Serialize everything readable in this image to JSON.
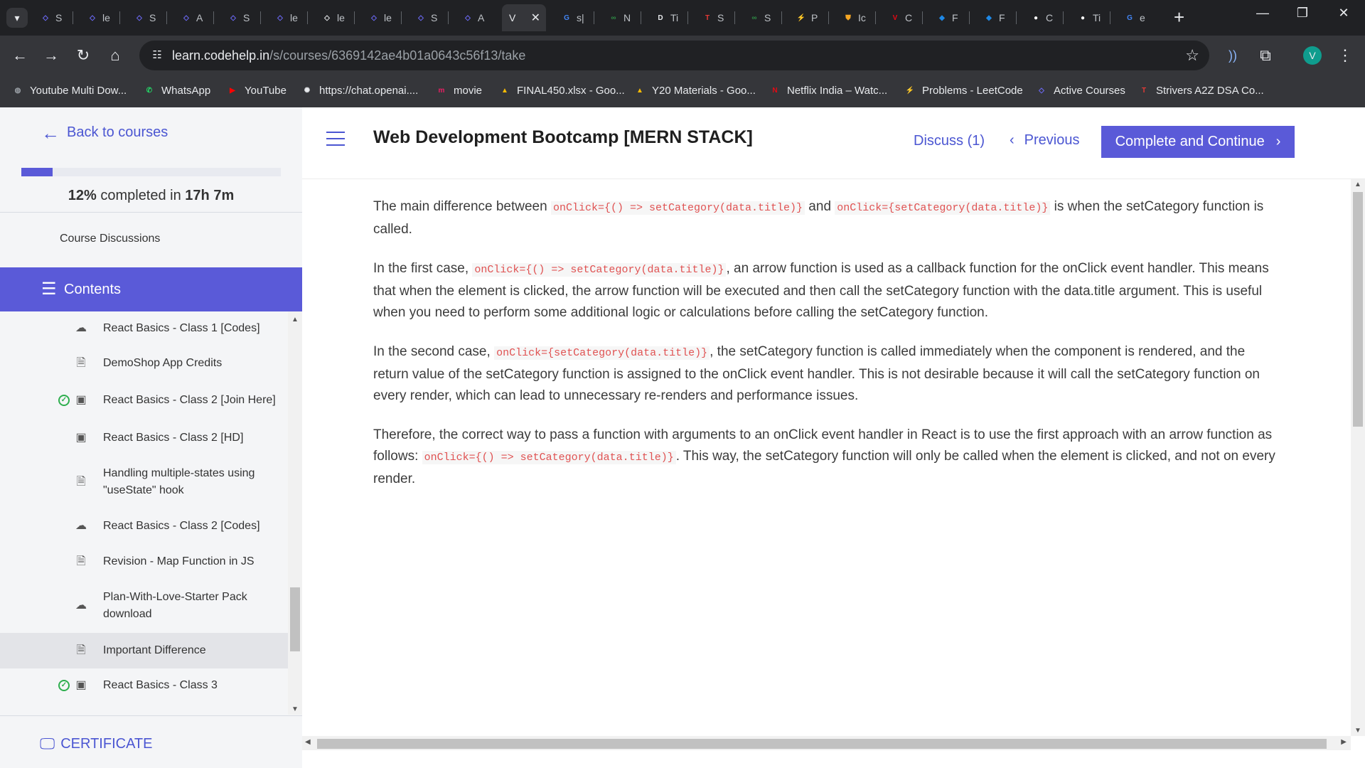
{
  "browser": {
    "tabs": [
      {
        "title": "S",
        "icon": "codehelp-icon",
        "color": "#6f6cff"
      },
      {
        "title": "le",
        "icon": "codehelp-icon",
        "color": "#6f6cff"
      },
      {
        "title": "S",
        "icon": "codehelp-icon",
        "color": "#6f6cff"
      },
      {
        "title": "A",
        "icon": "codehelp-icon",
        "color": "#6f6cff"
      },
      {
        "title": "S",
        "icon": "codehelp-icon",
        "color": "#6f6cff"
      },
      {
        "title": "le",
        "icon": "codehelp-icon",
        "color": "#6f6cff"
      },
      {
        "title": "le",
        "icon": "code-icon",
        "color": "#e8eaed"
      },
      {
        "title": "le",
        "icon": "codehelp-icon",
        "color": "#6f6cff"
      },
      {
        "title": "S",
        "icon": "codehelp-icon",
        "color": "#6f6cff"
      },
      {
        "title": "A",
        "icon": "codehelp-icon",
        "color": "#6f6cff"
      },
      {
        "title": "V",
        "icon": "",
        "color": "#e8eaed",
        "active": true
      },
      {
        "title": "s|",
        "icon": "google-icon",
        "color": "#4285f4"
      },
      {
        "title": "N",
        "icon": "gfg-icon",
        "color": "#2f8d46"
      },
      {
        "title": "Ti",
        "icon": "dev-icon",
        "color": "#e8eaed"
      },
      {
        "title": "S",
        "icon": "tuf-icon",
        "color": "#e53935"
      },
      {
        "title": "S",
        "icon": "gfg-icon",
        "color": "#2f8d46"
      },
      {
        "title": "P",
        "icon": "leetcode-icon",
        "color": "#ffa116"
      },
      {
        "title": "Ic",
        "icon": "shield-icon",
        "color": "#f5a623"
      },
      {
        "title": "C",
        "icon": "v-logo-icon",
        "color": "#e50914"
      },
      {
        "title": "F",
        "icon": "diamond-icon",
        "color": "#1e88e5"
      },
      {
        "title": "F",
        "icon": "diamond-icon",
        "color": "#1e88e5"
      },
      {
        "title": "C",
        "icon": "circle-icon",
        "color": "#ffffff"
      },
      {
        "title": "Ti",
        "icon": "circle-icon",
        "color": "#ffffff"
      },
      {
        "title": "e",
        "icon": "google-icon",
        "color": "#4285f4"
      }
    ],
    "url_domain": "learn.codehelp.in",
    "url_path": "/s/courses/6369142ae4b01a0643c56f13/take",
    "profile_initial": "V",
    "profile_color": "#0f9d8e",
    "bookmarks": [
      {
        "label": "Youtube Multi Dow...",
        "icon": "globe-icon",
        "color": "#9aa0a6"
      },
      {
        "label": "WhatsApp",
        "icon": "whatsapp-icon",
        "color": "#25d366"
      },
      {
        "label": "YouTube",
        "icon": "youtube-icon",
        "color": "#ff0000"
      },
      {
        "label": "https://chat.openai....",
        "icon": "openai-icon",
        "color": "#e8eaed"
      },
      {
        "label": "movie",
        "icon": "movie-icon",
        "color": "#e91e63"
      },
      {
        "label": "FINAL450.xlsx - Goo...",
        "icon": "drive-icon",
        "color": "#fbbc04"
      },
      {
        "label": "Y20 Materials - Goo...",
        "icon": "drive-icon",
        "color": "#fbbc04"
      },
      {
        "label": "Netflix India – Watc...",
        "icon": "netflix-icon",
        "color": "#e50914"
      },
      {
        "label": "Problems - LeetCode",
        "icon": "leetcode-icon",
        "color": "#ffa116"
      },
      {
        "label": "Active Courses",
        "icon": "codehelp-icon",
        "color": "#6f6cff"
      },
      {
        "label": "Strivers A2Z DSA Co...",
        "icon": "tuf-icon",
        "color": "#e53935"
      }
    ]
  },
  "sidebar": {
    "back_label": "Back to courses",
    "progress_percent": 12,
    "progress_pct_text": "12%",
    "progress_mid": " completed in ",
    "progress_time": "17h 7m",
    "course_discussions": "Course Discussions",
    "contents_label": "Contents",
    "lessons": [
      {
        "title": "React Basics - Class 1 [Codes]",
        "type": "download",
        "done": false
      },
      {
        "title": "DemoShop App Credits",
        "type": "document",
        "done": false
      },
      {
        "title": "React Basics - Class 2 [Join Here]",
        "type": "video",
        "done": true
      },
      {
        "title": "React Basics - Class 2 [HD]",
        "type": "video",
        "done": false
      },
      {
        "title": "Handling multiple-states using \"useState\" hook",
        "type": "document",
        "done": false
      },
      {
        "title": "React Basics - Class 2 [Codes]",
        "type": "download",
        "done": false
      },
      {
        "title": "Revision - Map Function in JS",
        "type": "document",
        "done": false
      },
      {
        "title": "Plan-With-Love-Starter Pack download",
        "type": "download",
        "done": false
      },
      {
        "title": "Important Difference",
        "type": "document",
        "done": false,
        "active": true
      },
      {
        "title": "React Basics - Class 3",
        "type": "video",
        "done": true
      }
    ],
    "certificate_label": "CERTIFICATE"
  },
  "header": {
    "course_title": "Web Development Bootcamp [MERN STACK]",
    "discuss_label": "Discuss (1)",
    "previous_label": "Previous",
    "complete_label": "Complete and Continue"
  },
  "article": {
    "p1": {
      "t1": "The main difference between ",
      "c1": "onClick={() => setCategory(data.title)}",
      "t2": " and ",
      "c2": "onClick={setCategory(data.title)}",
      "t3": " is when the setCategory function is called."
    },
    "p2": {
      "t1": "In the first case, ",
      "c1": "onClick={() => setCategory(data.title)}",
      "t2": ", an arrow function is used as a callback function for the onClick event handler. This means that when the element is clicked, the arrow function will be executed and then call the setCategory function with the data.title argument. This is useful when you need to perform some additional logic or calculations before calling the setCategory function."
    },
    "p3": {
      "t1": "In the second case, ",
      "c1": "onClick={setCategory(data.title)}",
      "t2": ", the setCategory function is called immediately when the component is rendered, and the return value of the setCategory function is assigned to the onClick event handler. This is not desirable because it will call the setCategory function on every render, which can lead to unnecessary re-renders and performance issues."
    },
    "p4": {
      "t1": "Therefore, the correct way to pass a function with arguments to an onClick event handler in React is to use the first approach with an arrow function as follows: ",
      "c1": "onClick={() => setCategory(data.title)}",
      "t2": ". This way, the setCategory function will only be called when the element is clicked, and not on every render."
    }
  },
  "colors": {
    "accent": "#5a5ad8",
    "link": "#4b56d2",
    "code": "#e05252",
    "done": "#2eae4e"
  }
}
